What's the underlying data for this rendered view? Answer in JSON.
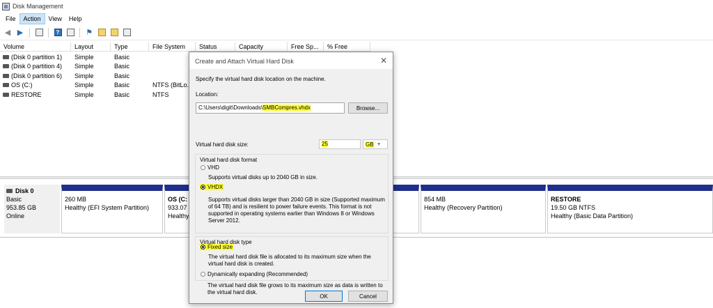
{
  "app": {
    "title": "Disk Management"
  },
  "menu": {
    "items": [
      "File",
      "Action",
      "View",
      "Help"
    ],
    "active": "Action"
  },
  "toolbar": {
    "icons": [
      "back-arrow-icon",
      "forward-arrow-icon",
      "grid-icon",
      "help-icon",
      "list-icon",
      "flag-icon",
      "new-icon",
      "search-icon",
      "properties-icon"
    ]
  },
  "volumes": {
    "columns": [
      "Volume",
      "Layout",
      "Type",
      "File System",
      "Status",
      "Capacity",
      "Free Sp...",
      "% Free"
    ],
    "rows": [
      [
        "(Disk 0 partition 1)",
        "Simple",
        "Basic",
        "",
        "",
        "",
        "",
        ""
      ],
      [
        "(Disk 0 partition 4)",
        "Simple",
        "Basic",
        "",
        "",
        "",
        "",
        ""
      ],
      [
        "(Disk 0 partition 6)",
        "Simple",
        "Basic",
        "",
        "",
        "",
        "",
        ""
      ],
      [
        "OS (C:)",
        "Simple",
        "Basic",
        "NTFS (BitLo...",
        "",
        "",
        "",
        ""
      ],
      [
        "RESTORE",
        "Simple",
        "Basic",
        "NTFS",
        "",
        "",
        "",
        ""
      ]
    ]
  },
  "disk": {
    "name": "Disk 0",
    "type": "Basic",
    "size": "953.85 GB",
    "status": "Online",
    "partitions": [
      {
        "name": "",
        "size": "260 MB",
        "status": "Healthy (EFI System Partition)"
      },
      {
        "name": "OS  (C:",
        "size": "933.07",
        "status": "Healthy"
      },
      {
        "name": "",
        "size": "854 MB",
        "status": "Healthy (Recovery Partition)"
      },
      {
        "name": "RESTORE",
        "size": "19.50 GB NTFS",
        "status": "Healthy (Basic Data Partition)"
      }
    ]
  },
  "dialog": {
    "title": "Create and Attach Virtual Hard Disk",
    "intro": "Specify the virtual hard disk location on the machine.",
    "location_label": "Location:",
    "location_prefix": "C:\\Users\\digit\\Downloads\\",
    "location_file": "SMBCompres.vhdx",
    "browse_label": "Browse...",
    "size_label": "Virtual hard disk size:",
    "size_value": "25",
    "size_unit": "GB",
    "format_group": {
      "title": "Virtual hard disk format",
      "options": [
        {
          "label": "VHD",
          "desc": "Supports virtual disks up to 2040 GB in size.",
          "checked": false
        },
        {
          "label": "VHDX",
          "desc": "Supports virtual disks larger than 2040 GB in size (Supported maximum of 64 TB) and is resilient to power failure events. This format is not supported in operating systems earlier than Windows 8 or Windows Server 2012.",
          "checked": true
        }
      ]
    },
    "type_group": {
      "title": "Virtual hard disk type",
      "options": [
        {
          "label": "Fixed size",
          "desc": "The virtual hard disk file is allocated to its maximum size when the virtual hard disk is created.",
          "checked": true
        },
        {
          "label": "Dynamically expanding (Recommended)",
          "desc": "The virtual hard disk file grows to its maximum size as data is written to the virtual hard disk.",
          "checked": false
        }
      ]
    },
    "ok_label": "OK",
    "cancel_label": "Cancel"
  },
  "colors": {
    "partition_bar": "#1f2f8a",
    "highlight": "#ffff33",
    "menu_active": "#cce4f7"
  }
}
